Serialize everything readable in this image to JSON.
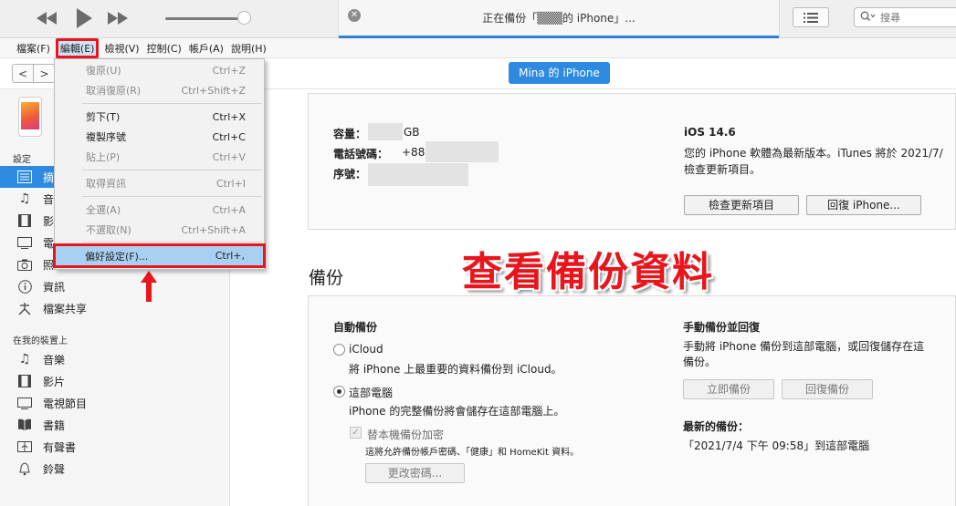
{
  "titlebar": {
    "rewind_icon": "rewind-icon",
    "play_icon": "play-icon",
    "forward_icon": "fast-forward-icon",
    "volume": 0.92,
    "status_text": "正在備份「▒▒▒的 iPhone」...",
    "list_icon": "list-icon",
    "search_placeholder": "搜尋"
  },
  "menubar": {
    "items": [
      "檔案(F)",
      "編輯(E)",
      "檢視(V)",
      "控制(C)",
      "帳戶(A)",
      "說明(H)"
    ]
  },
  "edit_menu": {
    "items": [
      {
        "label": "復原(U)",
        "shortcut": "Ctrl+Z"
      },
      {
        "label": "取消復原(R)",
        "shortcut": "Ctrl+Shift+Z"
      },
      {
        "label": "剪下(T)",
        "shortcut": "Ctrl+X"
      },
      {
        "label": "複製序號",
        "shortcut": "Ctrl+C"
      },
      {
        "label": "貼上(P)",
        "shortcut": "Ctrl+V"
      },
      {
        "label": "取得資訊",
        "shortcut": "Ctrl+I"
      },
      {
        "label": "全選(A)",
        "shortcut": "Ctrl+A"
      },
      {
        "label": "不選取(N)",
        "shortcut": "Ctrl+Shift+A"
      },
      {
        "label": "偏好設定(F)...",
        "shortcut": "Ctrl+,"
      }
    ]
  },
  "nav": {
    "back": "<",
    "forward": ">",
    "device_tab": "Mina 的 iPhone"
  },
  "sidebar": {
    "settings_header": "設定",
    "settings_items": [
      {
        "label": "摘",
        "icon": "summary-icon"
      },
      {
        "label": "音",
        "icon": "music-note-icon"
      },
      {
        "label": "影",
        "icon": "film-icon"
      },
      {
        "label": "電",
        "icon": "tv-icon"
      },
      {
        "label": "照",
        "icon": "camera-icon"
      },
      {
        "label": "資訊",
        "icon": "info-icon"
      },
      {
        "label": "檔案共享",
        "icon": "file-sharing-icon"
      }
    ],
    "device_header": "在我的裝置上",
    "device_items": [
      {
        "label": "音樂",
        "icon": "music-note-icon"
      },
      {
        "label": "影片",
        "icon": "film-icon"
      },
      {
        "label": "電視節目",
        "icon": "tv-icon"
      },
      {
        "label": "書籍",
        "icon": "book-icon"
      },
      {
        "label": "有聲書",
        "icon": "audiobook-icon"
      },
      {
        "label": "鈴聲",
        "icon": "bell-icon"
      }
    ]
  },
  "info": {
    "capacity_label": "容量：",
    "capacity_unit": "GB",
    "phone_label": "電話號碼：",
    "phone_prefix": "+886",
    "serial_label": "序號：",
    "ios_version": "iOS 14.6",
    "ios_desc_1": "您的 iPhone 軟體為最新版本。iTunes 將於 2021/7/",
    "ios_desc_2": "檢查更新項目。",
    "check_update_btn": "檢查更新項目",
    "restore_btn": "回復 iPhone..."
  },
  "backup": {
    "section_title": "備份",
    "auto_title": "自動備份",
    "icloud_label": "iCloud",
    "icloud_desc": "將 iPhone 上最重要的資料備份到 iCloud。",
    "computer_label": "這部電腦",
    "computer_desc": "iPhone 的完整備份將會儲存在這部電腦上。",
    "encrypt_label": "替本機備份加密",
    "encrypt_desc": "這將允許備份帳戶密碼、「健康」和 HomeKit 資料。",
    "change_pw_btn": "更改密碼...",
    "manual_title": "手動備份並回復",
    "manual_desc_1": "手動將 iPhone 備份到這部電腦，或回復儲存在這",
    "manual_desc_2": "備份。",
    "backup_now_btn": "立即備份",
    "restore_backup_btn": "回復備份",
    "latest_title": "最新的備份：",
    "latest_value": "「2021/7/4 下午 09:58」到這部電腦"
  },
  "annotation": {
    "overlay_title": "查看備份資料",
    "arrow_icon": "red-up-arrow-icon"
  }
}
